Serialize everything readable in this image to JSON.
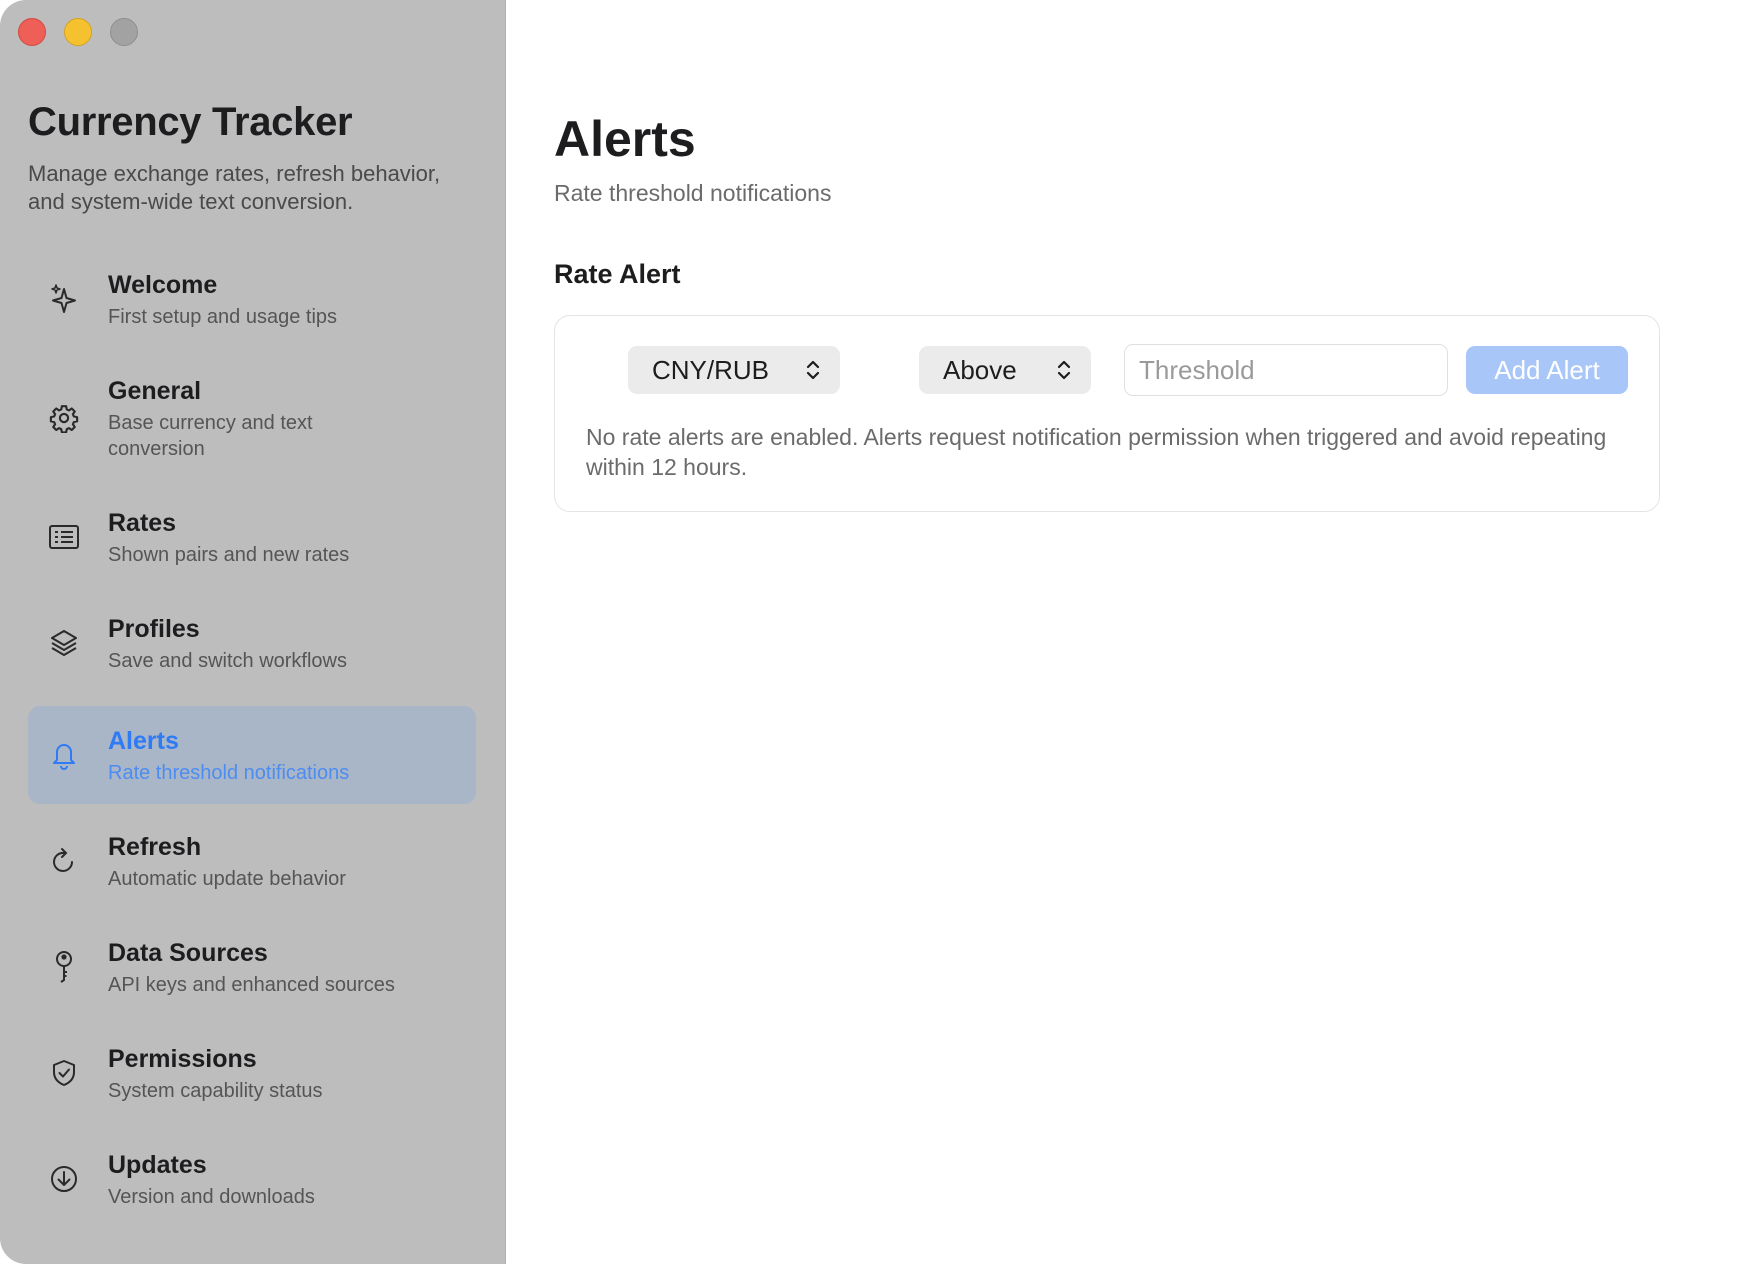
{
  "sidebar": {
    "app_title": "Currency Tracker",
    "app_description": "Manage exchange rates, refresh behavior, and system-wide text conversion.",
    "items": [
      {
        "label": "Welcome",
        "sub": "First setup and usage tips",
        "icon": "sparkles-icon"
      },
      {
        "label": "General",
        "sub": "Base currency and text conversion",
        "icon": "gear-icon"
      },
      {
        "label": "Rates",
        "sub": "Shown pairs and new rates",
        "icon": "list-icon"
      },
      {
        "label": "Profiles",
        "sub": "Save and switch workflows",
        "icon": "layers-icon"
      },
      {
        "label": "Alerts",
        "sub": "Rate threshold notifications",
        "icon": "bell-icon",
        "active": true
      },
      {
        "label": "Refresh",
        "sub": "Automatic update behavior",
        "icon": "refresh-icon"
      },
      {
        "label": "Data Sources",
        "sub": "API keys and enhanced sources",
        "icon": "key-icon"
      },
      {
        "label": "Permissions",
        "sub": "System capability status",
        "icon": "shield-check-icon"
      },
      {
        "label": "Updates",
        "sub": "Version and downloads",
        "icon": "download-circle-icon"
      }
    ]
  },
  "main": {
    "title": "Alerts",
    "subtitle": "Rate threshold notifications",
    "section_title": "Rate Alert",
    "pair_select": "CNY/RUB",
    "direction_select": "Above",
    "threshold_placeholder": "Threshold",
    "threshold_value": "",
    "add_button": "Add Alert",
    "note": "No rate alerts are enabled. Alerts request notification permission when triggered and avoid repeating within 12 hours."
  },
  "colors": {
    "accent": "#2f7bf5",
    "sidebar_bg": "#bdbdbd",
    "active_bg": "#a9b6c8",
    "button_disabled": "#a8c6f7"
  }
}
